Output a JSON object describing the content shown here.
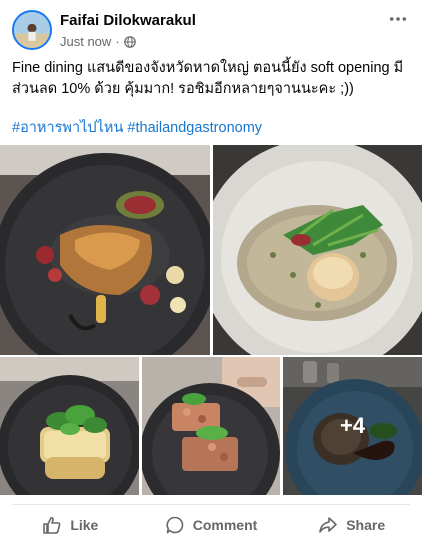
{
  "post": {
    "author": "Faifai Dilokwarakul",
    "timestamp": "Just now",
    "separator": "·",
    "privacy_icon": "globe-icon",
    "more_icon": "more-horizontal-icon",
    "caption": "Fine dining แสนดีของจังหวัดหาดใหญ่ ตอนนี้ยัง soft opening มีส่วนลด 10% ด้วย คุ้มมาก! รอชิมอีกหลายๆจานนะคะ ;))",
    "hashtags": [
      "#อาหารพาไปไหน",
      "#thailandgastronomy"
    ],
    "photos": {
      "more_count": "+4"
    }
  },
  "actions": {
    "like": "Like",
    "comment": "Comment",
    "share": "Share"
  },
  "colors": {
    "accent": "#1877f2",
    "hashtag": "#1876d0",
    "secondary_text": "#65676b"
  }
}
